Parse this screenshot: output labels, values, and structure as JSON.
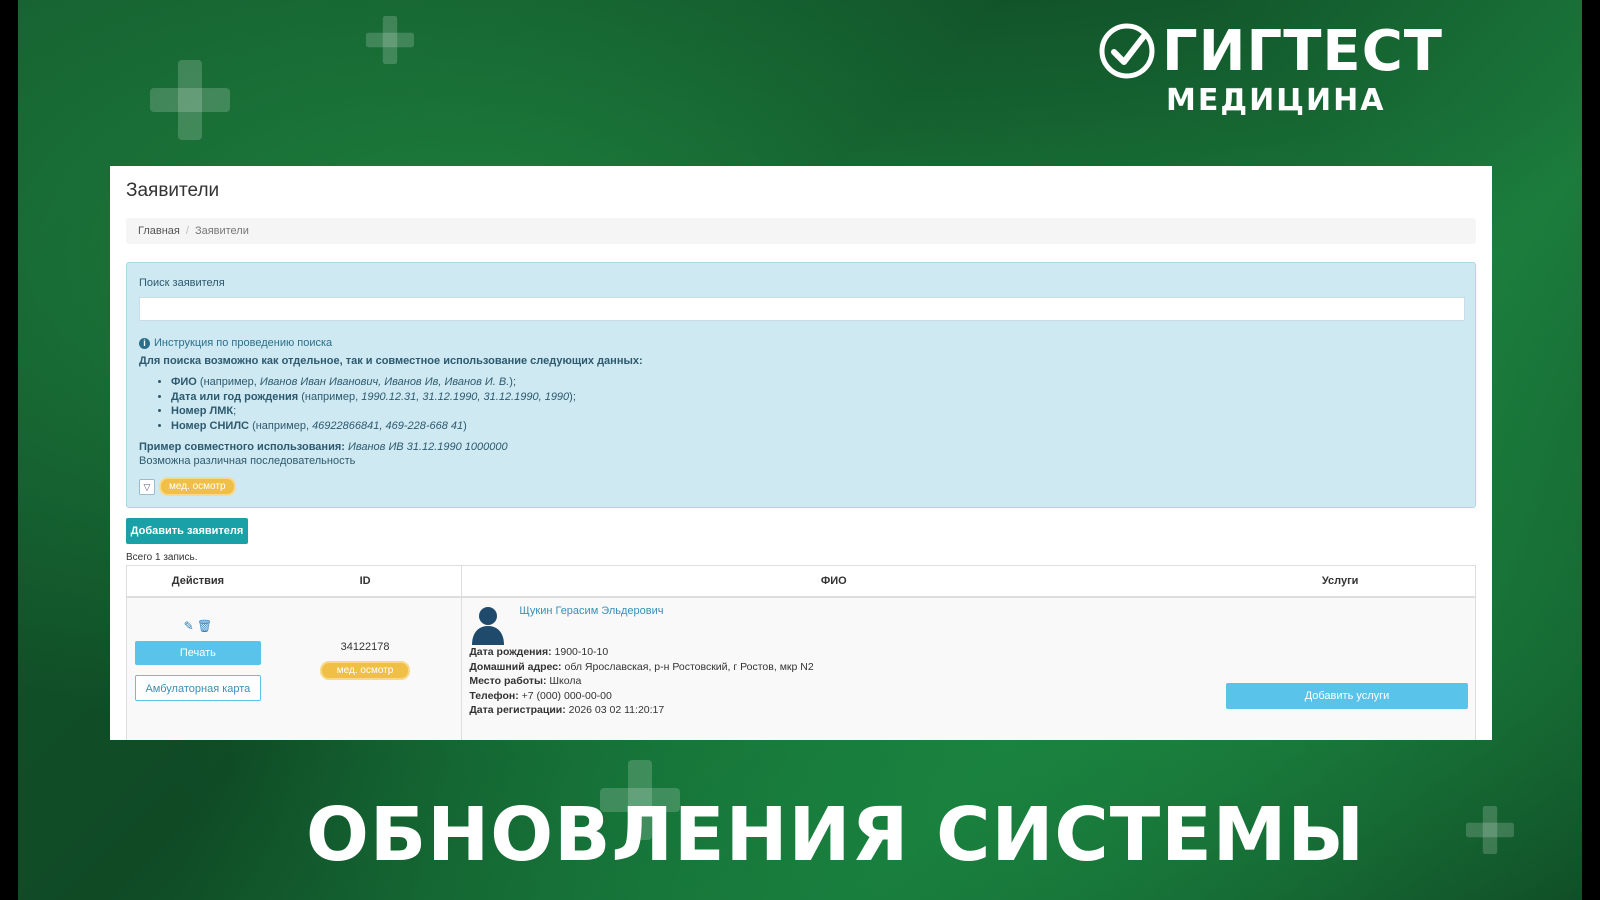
{
  "brand": {
    "title": "ГИГТЕСТ",
    "subtitle": "МЕДИЦИНА"
  },
  "banner": {
    "title": "ОБНОВЛЕНИЯ СИСТЕМЫ"
  },
  "page": {
    "title": "Заявители",
    "breadcrumb": [
      "Главная",
      "Заявители"
    ]
  },
  "search": {
    "label": "Поиск заявителя",
    "value": "",
    "instruction_title": "Инструкция по проведению поиска",
    "instruction_text": "Для поиска возможно как отдельное, так и совместное использование следующих данных:",
    "items": [
      {
        "bold": "ФИО",
        "rest": " (например, ",
        "italic": "Иванов Иван Иванович, Иванов Ив, Иванов И. В.",
        "tail": ");"
      },
      {
        "bold": "Дата или год рождения",
        "rest": " (например, ",
        "italic": "1990.12.31, 31.12.1990, 31.12.1990, 1990",
        "tail": ");"
      },
      {
        "bold": "Номер ЛМК",
        "rest": ";",
        "italic": "",
        "tail": ""
      },
      {
        "bold": "Номер СНИЛС",
        "rest": " (например, ",
        "italic": "46922866841, 469-228-668 41",
        "tail": ")"
      }
    ],
    "example_label": "Пример совместного использования:",
    "example_value": "Иванов ИВ 31.12.1990 1000000",
    "note": "Возможна различная последовательность",
    "filter_tag": "мед. осмотр"
  },
  "actions": {
    "add_applicant": "Добавить заявителя",
    "total": "Всего 1 запись."
  },
  "table": {
    "headers": [
      "Действия",
      "ID",
      "ФИО",
      "Услуги"
    ],
    "rows": [
      {
        "print": "Печать",
        "card": "Амбулаторная карта",
        "id": "34122178",
        "tag": "мед. осмотр",
        "fio": "Щукин Герасим Эльдерович",
        "birth_label": "Дата рождения:",
        "birth": "1900-10-10",
        "address_label": "Домашний адрес:",
        "address": "обл Ярославская, р-н Ростовский, г Ростов, мкр N2",
        "work_label": "Место работы:",
        "work": "Школа",
        "phone_label": "Телефон:",
        "phone": "+7 (000) 000-00-00",
        "reg_label": "Дата регистрации:",
        "reg": "2026 03 02 11:20:17",
        "add_service": "Добавить услуги"
      }
    ]
  },
  "colors": {
    "accent": "#1aa1a8",
    "info_bg": "#cfe9f3",
    "tag": "#f0c046",
    "button_light": "#5ac3ea"
  }
}
